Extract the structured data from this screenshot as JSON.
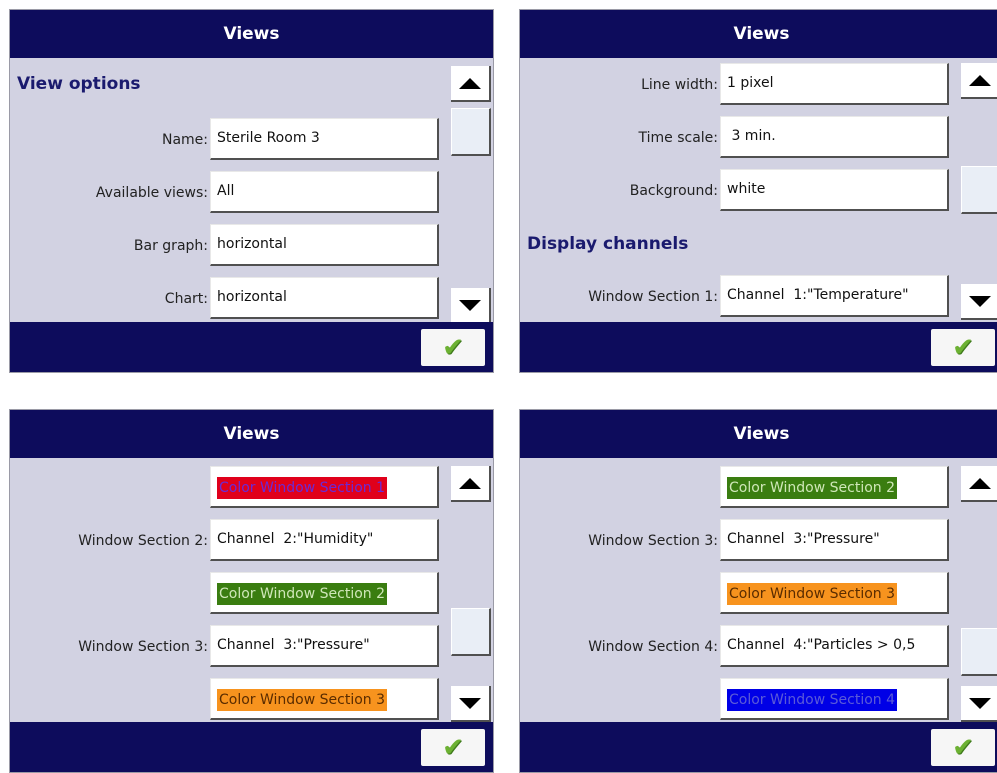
{
  "screens": [
    {
      "title": "Views",
      "section": "View options",
      "rows": [
        {
          "label": "Name:",
          "value": "Sterile Room 3"
        },
        {
          "label": "Available views:",
          "value": "All"
        },
        {
          "label": "Bar graph:",
          "value": "horizontal"
        },
        {
          "label": "Chart:",
          "value": "horizontal"
        }
      ]
    },
    {
      "title": "Views",
      "rows": [
        {
          "label": "Line width:",
          "value": "1 pixel"
        },
        {
          "label": "Time scale:",
          "value": " 3 min."
        },
        {
          "label": "Background:",
          "value": "white"
        }
      ],
      "section": "Display channels",
      "rows2": [
        {
          "label": "Window Section 1:",
          "value": "Channel  1:\"Temperature\""
        }
      ]
    },
    {
      "title": "Views",
      "rows": [
        {
          "label": "",
          "color_label": "Color Window Section 1"
        },
        {
          "label": "Window Section 2:",
          "value": "Channel  2:\"Humidity\""
        },
        {
          "label": "",
          "color_label": "Color Window Section 2"
        },
        {
          "label": "Window Section 3:",
          "value": "Channel  3:\"Pressure\""
        },
        {
          "label": "",
          "color_label": "Color Window Section 3"
        }
      ]
    },
    {
      "title": "Views",
      "rows": [
        {
          "label": "",
          "color_label": "Color Window Section 2"
        },
        {
          "label": "Window Section 3:",
          "value": "Channel  3:\"Pressure\""
        },
        {
          "label": "",
          "color_label": "Color Window Section 3"
        },
        {
          "label": "Window Section 4:",
          "value": "Channel  4:\"Particles > 0,5"
        },
        {
          "label": "",
          "color_label": "Color Window Section 4"
        }
      ]
    }
  ],
  "colors": {
    "title_bar": "#0d0c5c",
    "panel_bg": "#d2d2e2",
    "section_heading": "#1a1a6e",
    "section1": "#e0001b",
    "section1_text": "#6a2ad6",
    "section2": "#3a7d10",
    "section2_text": "#cfe7b8",
    "section3": "#f7931e",
    "section3_text": "#5a2c00",
    "section4": "#0000e6",
    "section4_text": "#5a5ad8",
    "ok_check": "#6cb132"
  },
  "icons": {
    "scroll_up": "triangle-up",
    "scroll_down": "triangle-down",
    "ok": "check-mark"
  },
  "scroll_position": [
    0.0,
    0.33,
    0.85,
    0.85
  ]
}
